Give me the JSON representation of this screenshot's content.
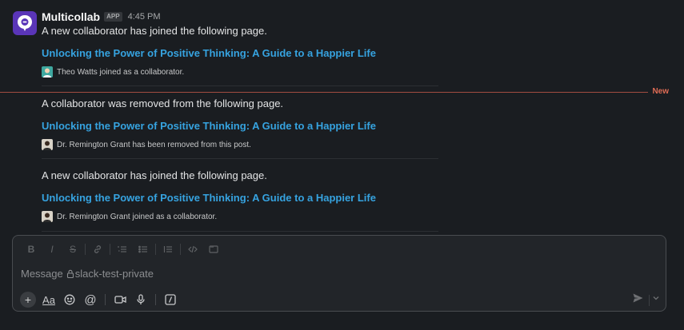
{
  "message": {
    "sender": "Multicollab",
    "badge": "APP",
    "time": "4:45 PM",
    "avatar_icon": "multicollab-logo-icon",
    "brand_color": "#5a35b8",
    "notifications": [
      {
        "text": "A new collaborator has joined the following page.",
        "link": "Unlocking the Power of Positive Thinking: A Guide to a Happier Life",
        "note": "Theo Watts joined as a collaborator."
      },
      {
        "text": "A collaborator was removed from the following page.",
        "link": "Unlocking the Power of Positive Thinking: A Guide to a Happier Life",
        "note": "Dr. Remington Grant has been removed from this post."
      },
      {
        "text": "A new collaborator has joined the following page.",
        "link": "Unlocking the Power of Positive Thinking: A Guide to a Happier Life",
        "note": "Dr. Remington Grant joined as a collaborator."
      }
    ]
  },
  "new_divider": {
    "label": "New",
    "color": "#e06c55"
  },
  "composer": {
    "placeholder_prefix": "Message",
    "channel": "slack-test-private",
    "formatting": [
      "bold-icon",
      "italic-icon",
      "strikethrough-icon",
      "link-icon",
      "ordered-list-icon",
      "bulleted-list-icon",
      "blockquote-icon",
      "code-icon",
      "code-block-icon"
    ],
    "bottom_actions": [
      "plus-icon",
      "formatting-toggle-icon",
      "emoji-icon",
      "mention-icon",
      "video-icon",
      "microphone-icon",
      "shortcuts-icon"
    ],
    "format_toggle_label": "Aa"
  }
}
